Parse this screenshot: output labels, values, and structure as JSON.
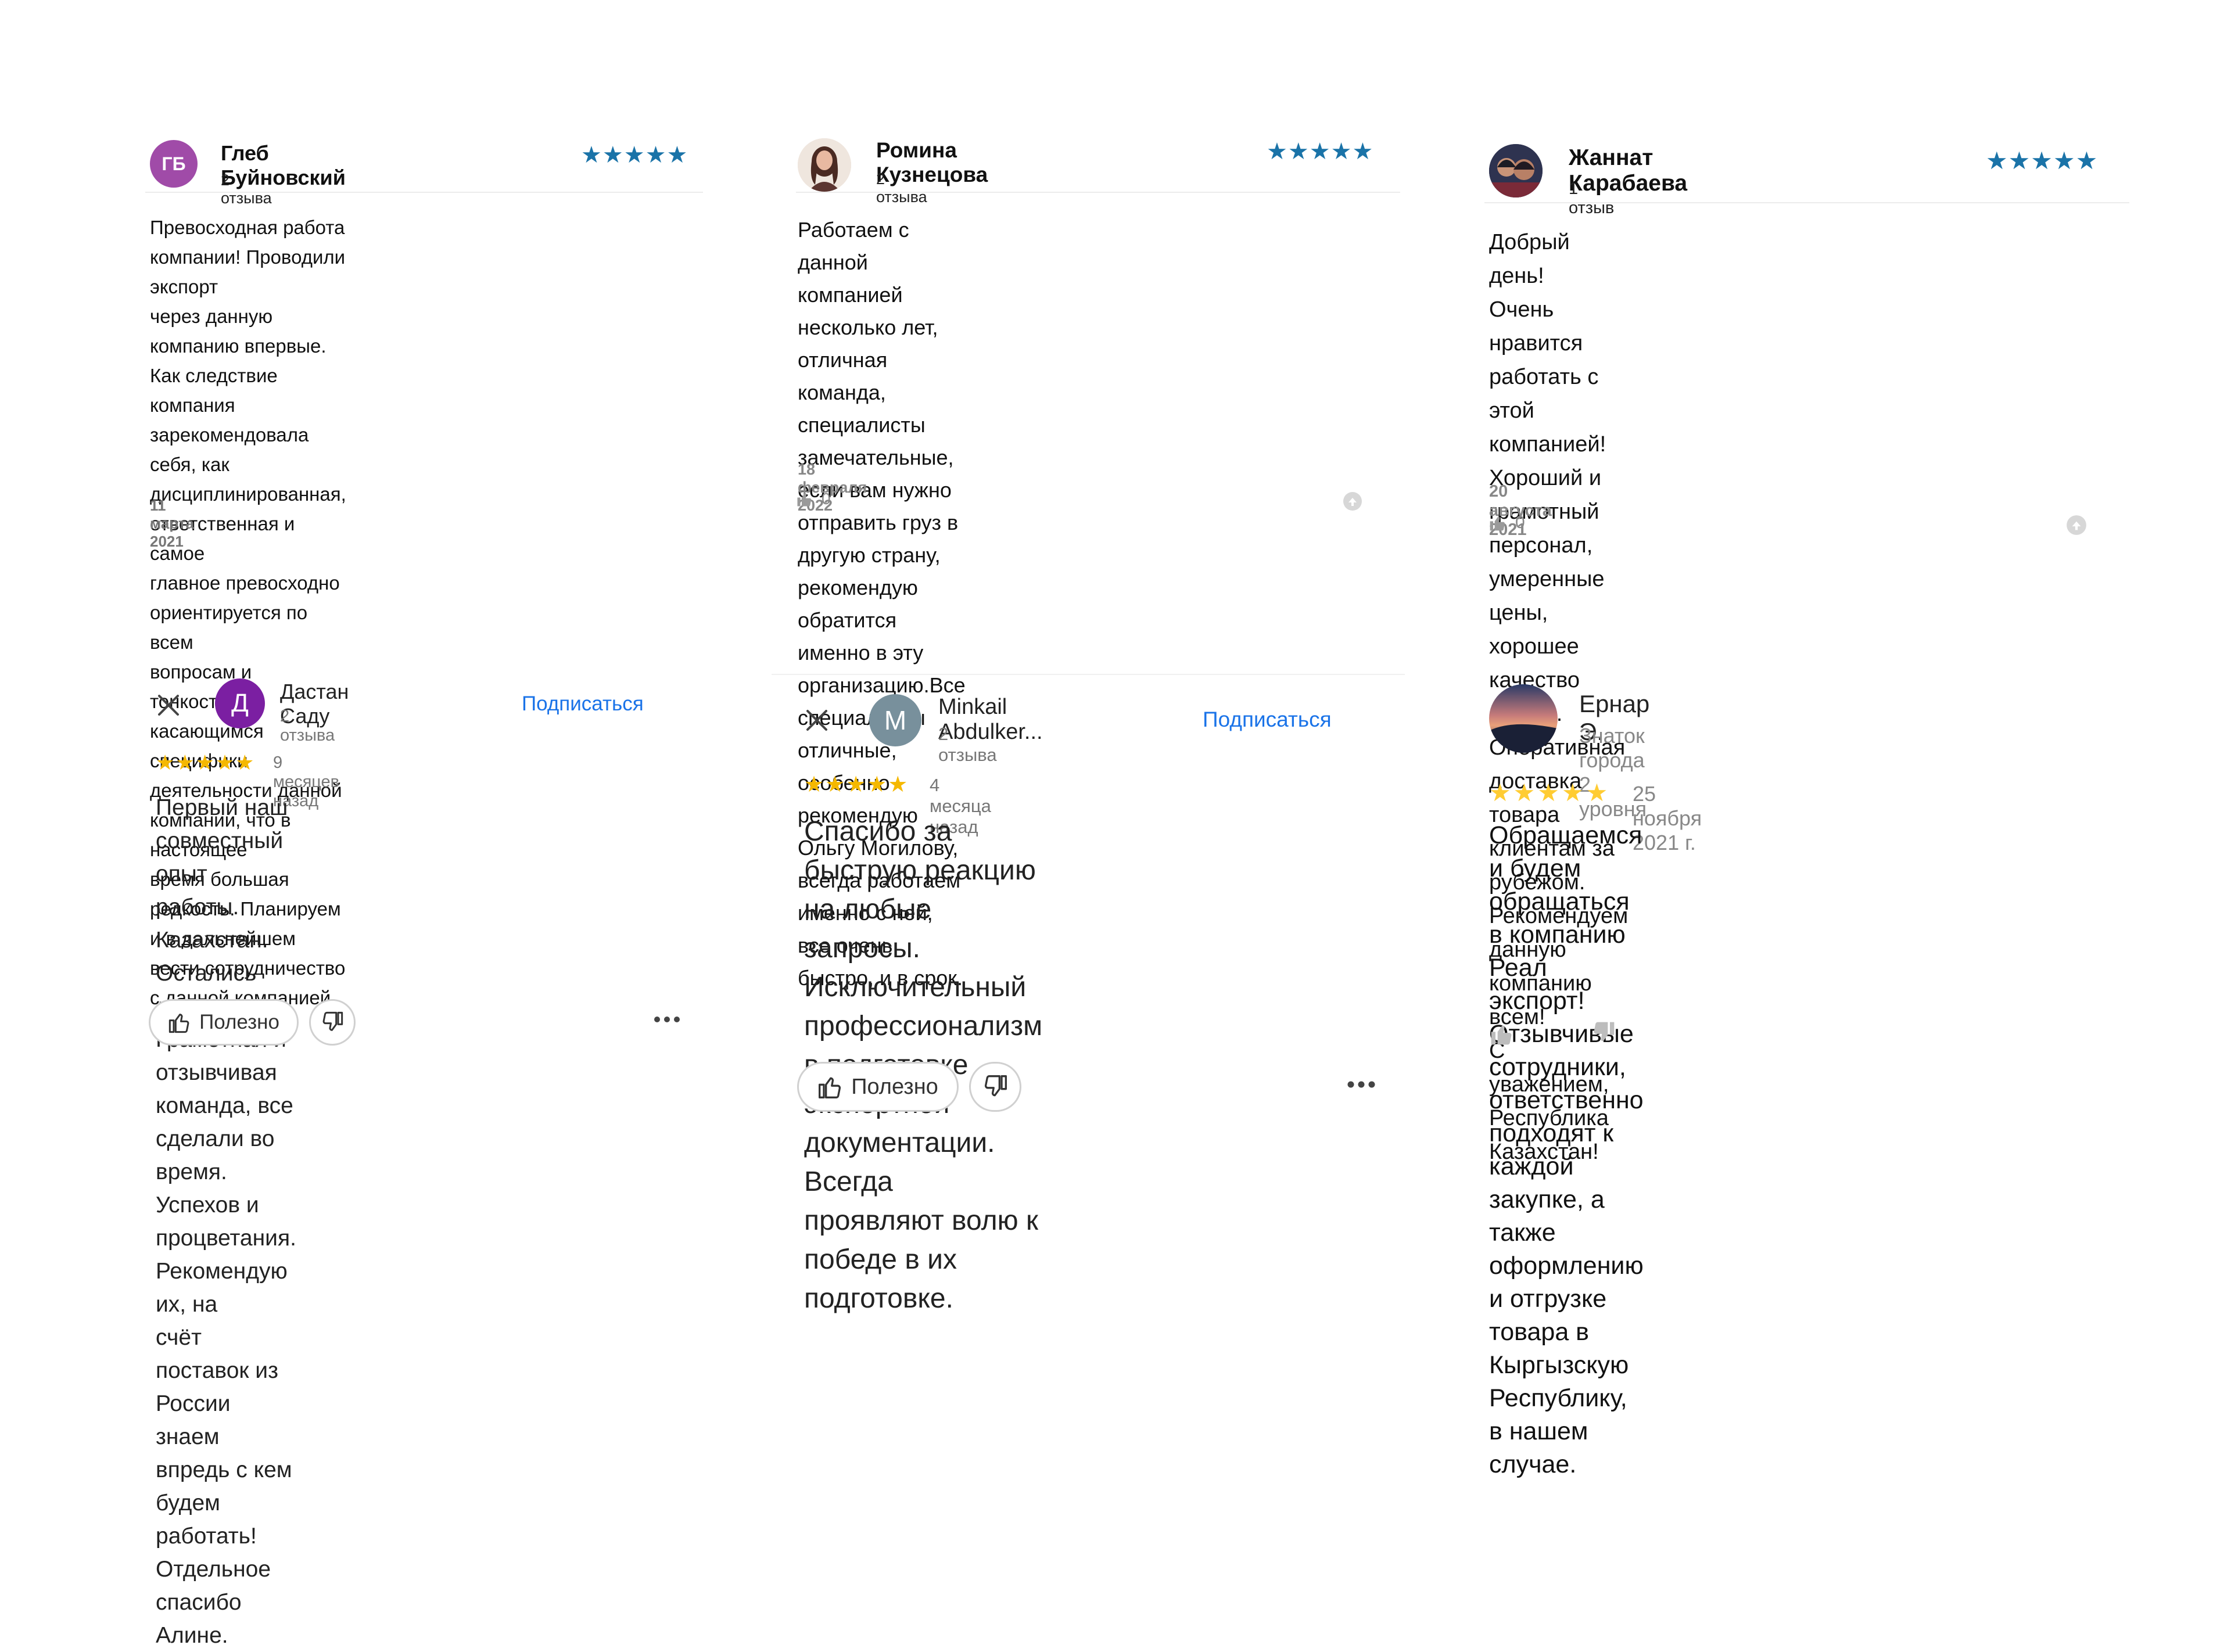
{
  "cards": [
    {
      "name": "Глеб Буйновский",
      "initials": "ГБ",
      "reviews": "2 отзыва",
      "rating": "★★★★★",
      "text": "Превосходная работа компании! Проводили экспорт\nчерез данную компанию впервые. Как следствие\nкомпания зарекомендовала себя, как\nдисциплинированная, ответственная и самое\nглавное превосходно ориентируется по всем\nвопросам и тонкостям, касающимся специфики\nдеятельности данной компании, что в настоящее\nвремя большая редкость. Планируем и в дальнейшем\nвести сотрудничество с данной компанией.",
      "date": "11 марта 2021"
    },
    {
      "name": "Ромина Кузнецова",
      "reviews": "2 отзыва",
      "rating": "★★★★★",
      "text": "Работаем с данной компанией несколько лет,\nотличная команда, специалисты замечательные,\nесли вам нужно отправить груз в другую страну,\nрекомендую обратится именно в эту\nорганизацию.Все специалисты отличные, особенно\nрекомендую Ольгу Могилову, всегда работаем\nименно с ней, все очень быстро, и в срок.",
      "date": "18 февраля 2022",
      "likes": "0"
    },
    {
      "name": "Жаннат Карабаева",
      "reviews": "1 отзыв",
      "rating": "★★★★★",
      "text": "Добрый день!\nОчень нравится работать с этой компанией!\nХороший и грамотный персонал, умеренные цены,\nхорошее качество краски.\nОперативная доставка товара клиентам за рубежом.\nРекомендуем данную компанию всем!\nС уважением, Республика Казахстан!",
      "date": "20 августа 2021",
      "likes": "0"
    },
    {
      "name": "Дастан Саду",
      "initial": "Д",
      "reviews": "2 отзыва",
      "subscribe": "Подписаться",
      "rating": "★★★★★",
      "time": "9 месяцев назад",
      "text": "Первый наш совместный опыт работы.\nКазахстан. Остались довольны. Грамотная и\nотзывчивая  команда, все сделали во время.\nУспехов и процветания. Рекомендую их, на\nсчёт поставок из России знаем впредь с кем\nбудем работать! Отдельное спасибо Алине.",
      "useful": "Полезно"
    },
    {
      "name": "Minkail Abdulker...",
      "initial": "M",
      "reviews": "2 отзыва",
      "subscribe": "Подписаться",
      "rating": "★★★★★",
      "time": "4 месяца назад",
      "text": "Спасибо за быструю реакцию на любые\nзапросы. Исключительный\nпрофессионализм в подготовке\nэкспортной документации.  Всегда\nпроявляют волю к победе в их\nподготовке.",
      "useful": "Полезно"
    },
    {
      "name": "Ернар Э.",
      "level": "Знаток города 2 уровня",
      "rating": "★★★★★",
      "date": "25 ноября 2021 г.",
      "text": "Обращаемся и будем обращаться в компанию\nРеал экспорт! Отзывчивые сотрудники,\nответственно подходят к каждой закупке, а\nтакже оформлению и отгрузке товара в\nКыргызскую Республику, в нашем случае."
    }
  ],
  "colors": {
    "avatar_gb": "#a04ba8",
    "avatar_d": "#7b1fa2",
    "avatar_m": "#78909c",
    "star_blue": "#1a73a8",
    "star_gold": "#f5b800",
    "star_yellow": "#ffcc33",
    "link": "#1a73e8"
  }
}
